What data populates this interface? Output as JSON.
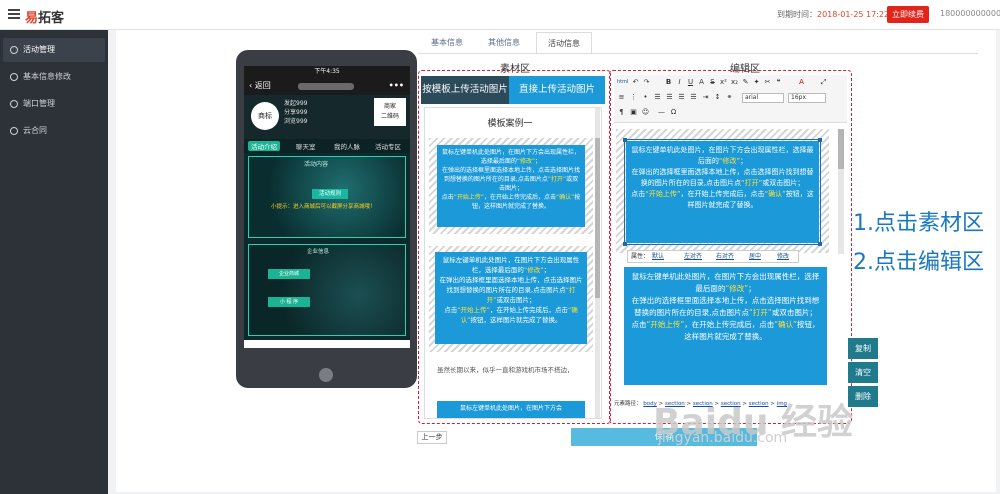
{
  "topbar": {
    "logo_accent": "易",
    "logo_rest": "拓客",
    "expire_label": "到期时间：",
    "expire_time": "2018-01-25 17:22:56",
    "renew_button": "立即续费",
    "account": "1800000000000"
  },
  "sidebar": {
    "items": [
      {
        "label": "活动管理"
      },
      {
        "label": "基本信息修改"
      },
      {
        "label": "端口管理"
      },
      {
        "label": "云合同"
      }
    ]
  },
  "tabs": [
    {
      "label": "基本信息"
    },
    {
      "label": "其他信息"
    },
    {
      "label": "活动信息"
    }
  ],
  "phone": {
    "status_time": "下午4:35",
    "back_label": "返回",
    "more_label": "•••",
    "avatar_label": "商标",
    "stats": [
      "发起999",
      "分享999",
      "浏览999"
    ],
    "qr_line1": "商家",
    "qr_line2": "二维码",
    "tabs": [
      "活动介绍",
      "聊天室",
      "我的人脉",
      "活动专区"
    ],
    "panel1_title": "活动内容",
    "panel1_button": "活动规则",
    "panel1_tip": "小提示：进入商城后可以截屏分享商城哦！",
    "panel2_title": "企业信息",
    "panel2_btn1": "企业商城",
    "panel2_btn2": "小 程 序"
  },
  "material": {
    "area_label": "素材区",
    "btn_template": "按模板上传活动图片",
    "btn_direct": "直接上传活动图片",
    "heading": "模板案例一",
    "card_text": {
      "p1a": "鼠标左键单机此处图片，在图片下方会出现属性栏，选择最后面的",
      "p1b": "“修改”",
      "p1c": "；",
      "p2": "在弹出的选择框里面选择本地上传，点击选择图片找到想替换的图片所在的目录,点击图片点",
      "p2b": "“打开”",
      "p2c": "或双击图片；",
      "p3a": "点击",
      "p3b": "“开始上传”",
      "p3c": "，在开始上传完成后，点击",
      "p3d": "“确认”",
      "p3e": "按钮，这样图片就完成了替换。"
    },
    "plain_text": "虽然长期以来，似乎一直和游戏机市场不搭边，",
    "bottom_card": "鼠标左键单机此处图片，在图片下方会"
  },
  "editor": {
    "area_label": "编辑区",
    "font_select": "arial",
    "size_select": "16px",
    "popbar": {
      "label": "属性：",
      "links": [
        "默认",
        "左对齐",
        "右对齐",
        "居中",
        "修改"
      ]
    },
    "path_label": "元素路径：",
    "path_items": [
      "body",
      "section",
      "section",
      "section",
      "section",
      "img"
    ],
    "side_buttons": [
      "复制",
      "清空",
      "删除"
    ]
  },
  "footer": {
    "prev": "上一步",
    "save": "保 存"
  },
  "annotations": {
    "line1": "1.点击素材区",
    "line2": "2.点击编辑区"
  },
  "watermark": {
    "brand": "Baidu 经验",
    "url": "jingyan.baidu.com"
  },
  "colors": {
    "accent_red": "#e2241b",
    "sidebar_bg": "#2d3138",
    "material_btn_dark": "#2b4a5a",
    "material_btn_teal": "#1c99d8",
    "card_blue": "#1c99d8",
    "annotation_blue": "#1a78c2",
    "frame_red": "#c8223a"
  }
}
